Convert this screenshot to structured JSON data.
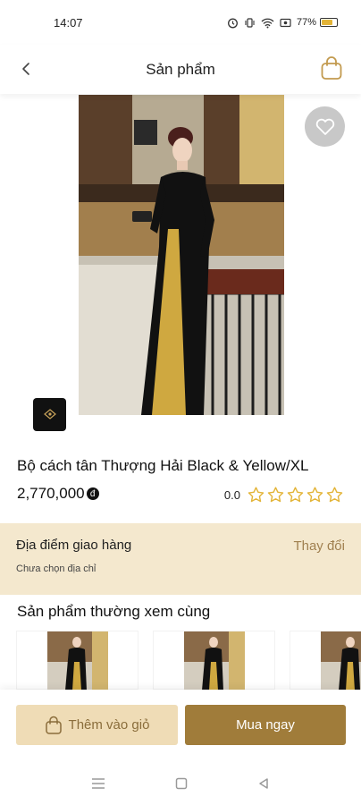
{
  "status_bar": {
    "time": "14:07",
    "battery_text": "77%",
    "battery_level": 0.77
  },
  "header": {
    "title": "Sản phẩm",
    "back_icon": "chevron-left-icon",
    "cart_icon": "shopping-bag-icon"
  },
  "product": {
    "name": "Bộ cách tân Thượng Hải Black & Yellow/XL",
    "price": "2,770,000",
    "currency_symbol": "đ",
    "rating_value": "0.0",
    "rating_stars": 0,
    "rating_max": 5,
    "favorite_icon": "heart-icon"
  },
  "delivery": {
    "title": "Địa điểm giao hàng",
    "change_label": "Thay đổi",
    "subtitle": "Chưa chọn địa chỉ"
  },
  "related": {
    "title": "Sản phẩm thường xem cùng"
  },
  "actions": {
    "add_to_cart_label": "Thêm vào giỏ",
    "buy_now_label": "Mua ngay"
  },
  "colors": {
    "accent": "#a07c3a",
    "accent_light": "#efdcb6",
    "delivery_bg": "#f4e8ce",
    "star": "#e3b437"
  }
}
